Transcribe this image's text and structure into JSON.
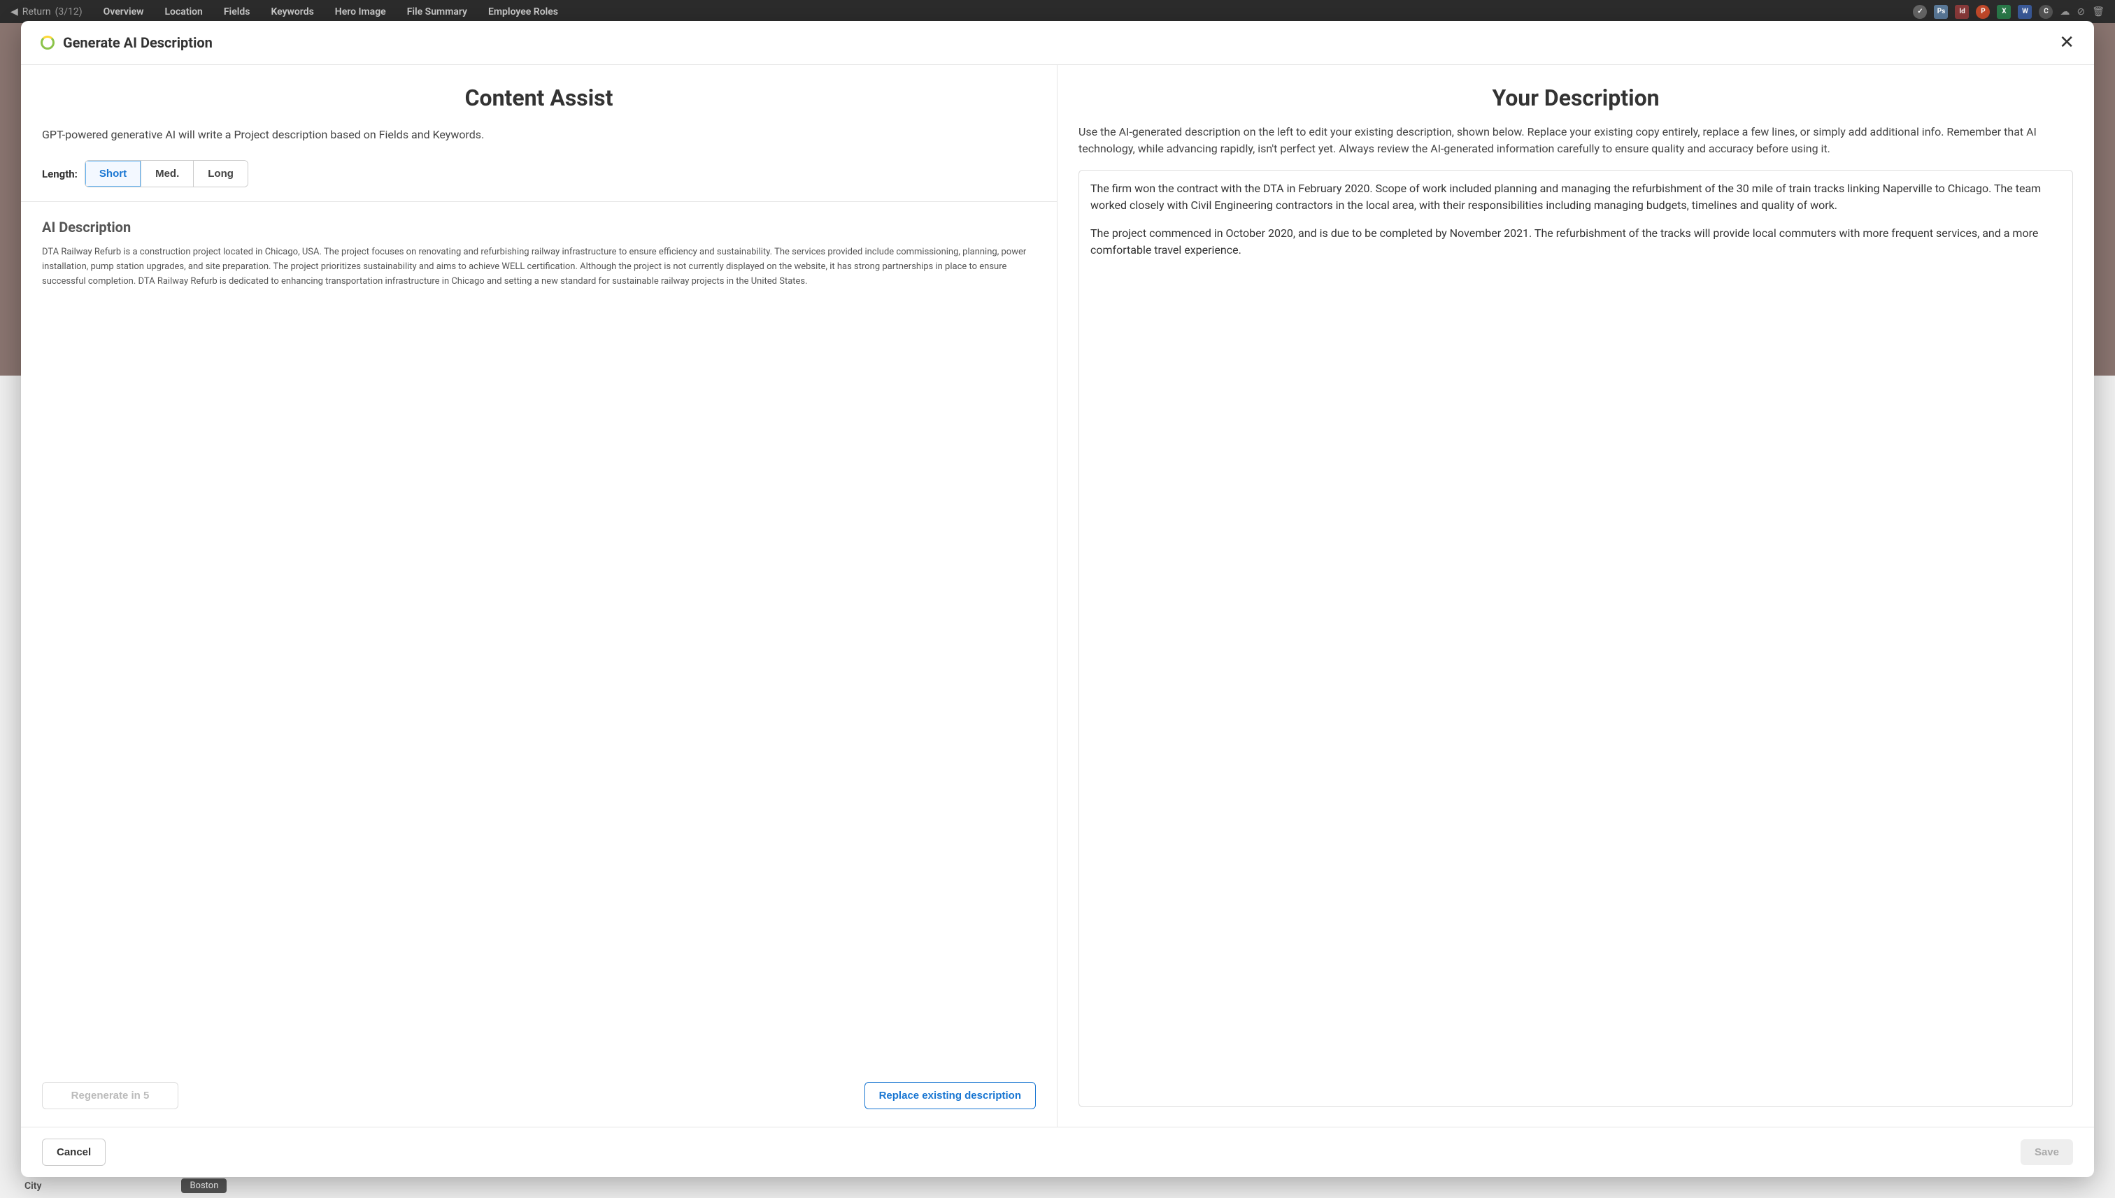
{
  "topbar": {
    "return_label": "Return",
    "return_count": "(3/12)",
    "tabs": [
      "Overview",
      "Location",
      "Fields",
      "Keywords",
      "Hero Image",
      "File Summary",
      "Employee Roles"
    ]
  },
  "modal": {
    "title": "Generate AI Description"
  },
  "left": {
    "heading": "Content Assist",
    "subtext": "GPT-powered generative AI will write a Project description based on Fields and Keywords.",
    "length_label": "Length:",
    "length_options": {
      "short": "Short",
      "med": "Med.",
      "long": "Long"
    },
    "ai_desc_title": "AI Description",
    "ai_desc_text": "DTA Railway Refurb is a construction project located in Chicago, USA. The project focuses on renovating and refurbishing railway infrastructure to ensure efficiency and sustainability. The services provided include commissioning, planning, power installation, pump station upgrades, and site preparation. The project prioritizes sustainability and aims to achieve WELL certification. Although the project is not currently displayed on the website, it has strong partnerships in place to ensure successful completion. DTA Railway Refurb is dedicated to enhancing transportation infrastructure in Chicago and setting a new standard for sustainable railway projects in the United States.",
    "regenerate_label": "Regenerate in 5",
    "replace_label": "Replace existing description"
  },
  "right": {
    "heading": "Your Description",
    "instructions": "Use the AI-generated description on the left to edit your existing description, shown below. Replace your existing copy entirely, replace a few lines, or simply add additional info. Remember that AI technology, while advancing rapidly, isn't perfect yet. Always review the AI-generated information carefully to ensure quality and accuracy before using it.",
    "description_p1": "The firm won the contract with the DTA in February 2020. Scope of work included planning and managing the refurbishment of the 30 mile of train tracks linking Naperville to Chicago. The team worked closely with Civil Engineering contractors in the local area, with their responsibilities including managing budgets, timelines and quality of work.",
    "description_p2": "The project commenced in October 2020, and is due to be completed by November 2021. The refurbishment of the tracks will provide local commuters with more frequent services, and a more comfortable travel experience."
  },
  "footer": {
    "cancel_label": "Cancel",
    "save_label": "Save"
  },
  "background": {
    "city_label": "City",
    "city_value": "Boston"
  }
}
